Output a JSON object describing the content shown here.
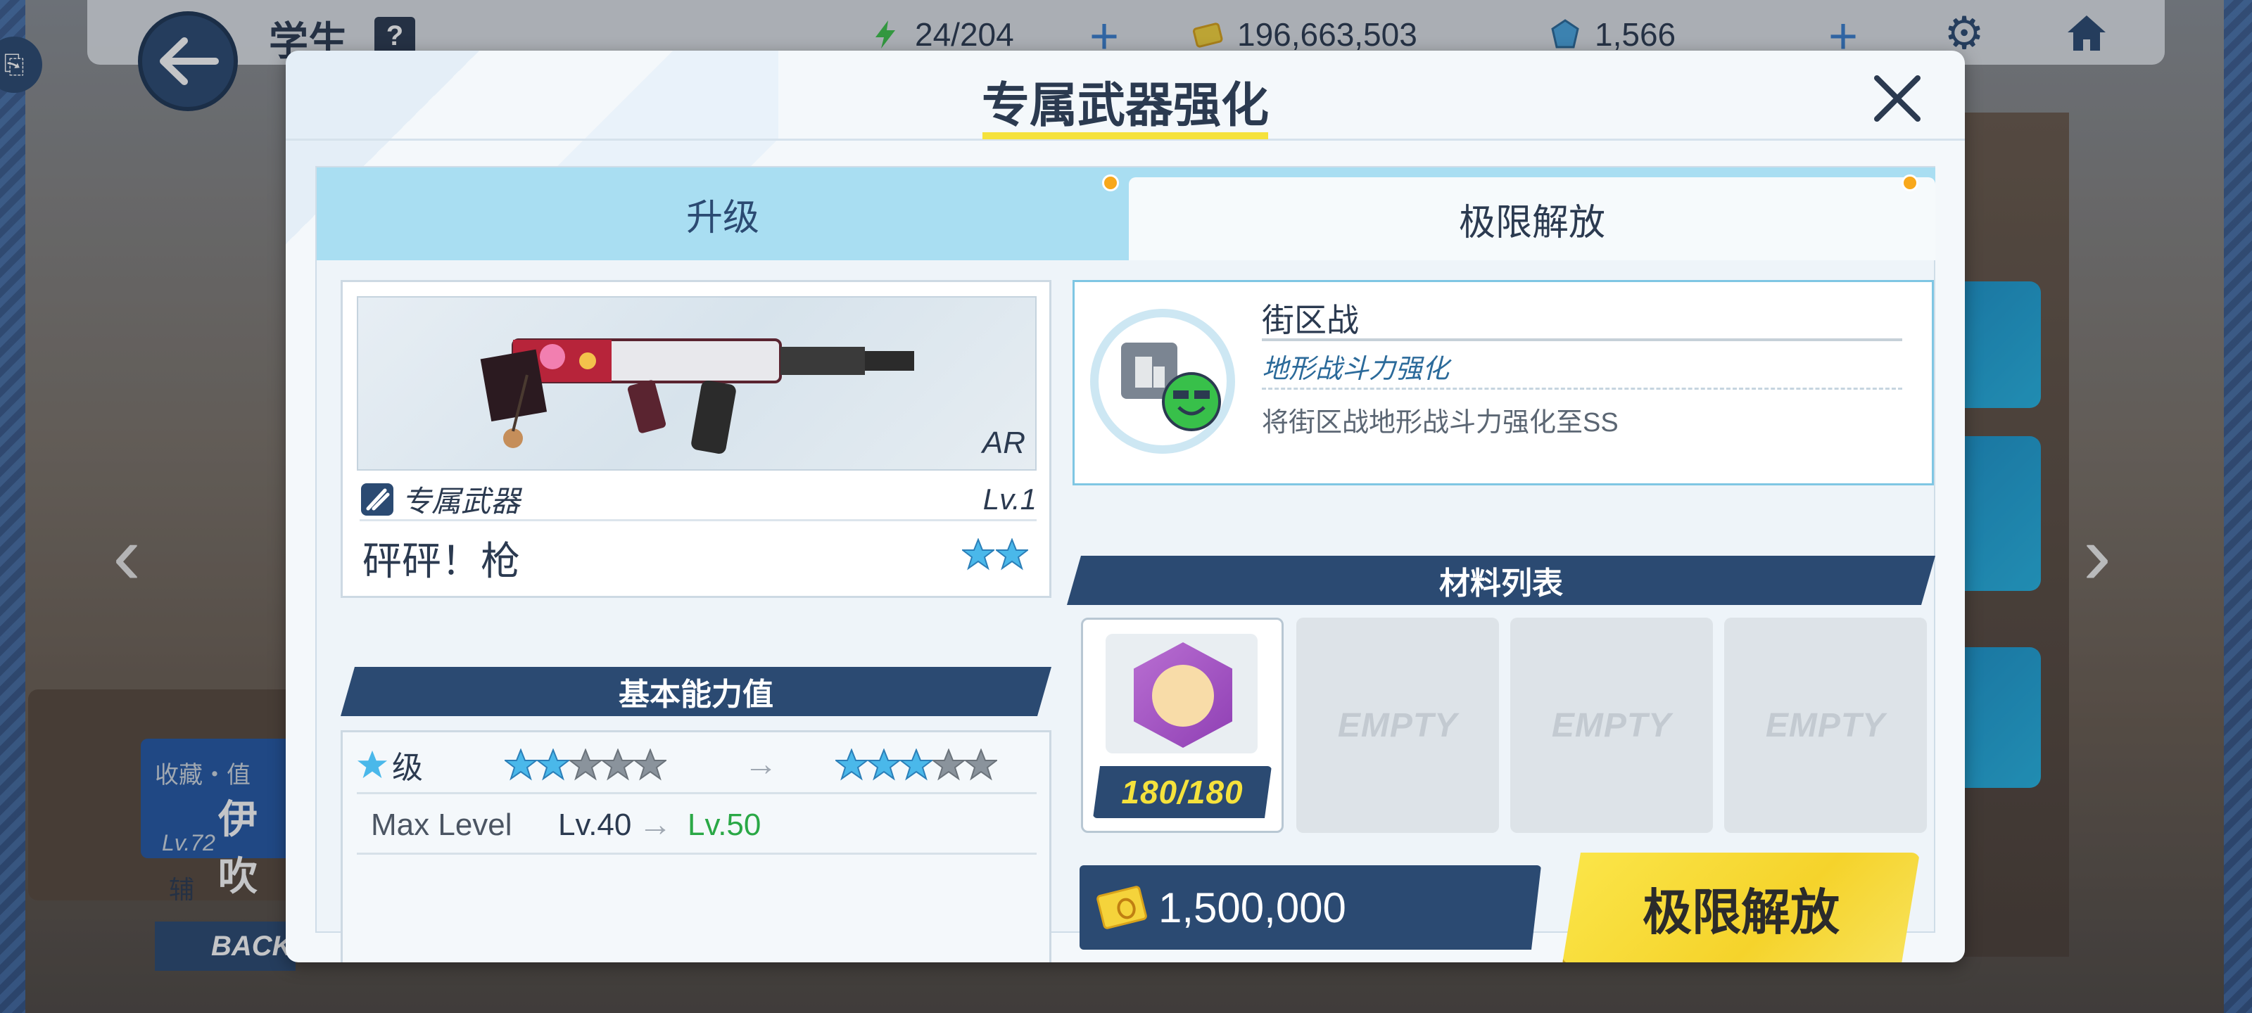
{
  "topbar": {
    "title": "学生",
    "help": "?",
    "ap": "24/204",
    "credits": "196,663,503",
    "gems": "1,566"
  },
  "background": {
    "back_label": "BACK",
    "name_partial": "伊吹",
    "level": "Lv.72",
    "favorite_label": "收藏・值",
    "support_label": "辅"
  },
  "modal": {
    "title": "专属武器强化",
    "tabs": [
      {
        "label": "升级"
      },
      {
        "label": "极限解放"
      }
    ],
    "weapon": {
      "type": "AR",
      "category": "专属武器",
      "level": "Lv.1",
      "name": "砰砰！枪",
      "stars": 2
    },
    "stats": {
      "header": "基本能力值",
      "grade_label": "级",
      "from_stars": 2,
      "to_stars": 3,
      "total_stars": 5,
      "max_level_label": "Max Level",
      "max_level_from": "Lv.40",
      "max_level_to": "Lv.50"
    },
    "terrain": {
      "title": "街区战",
      "subtitle": "地形战斗力强化",
      "description": "将街区战地形战斗力强化至SS"
    },
    "materials": {
      "header": "材料列表",
      "item_count": "180/180",
      "empty_label": "EMPTY"
    },
    "cost": "1,500,000",
    "action_label": "极限解放"
  },
  "colors": {
    "navy": "#2b4a72",
    "accent_yellow": "#f5e23c",
    "tab_blue": "#a9def2",
    "green": "#2aa846",
    "star_blue": "#4ab8ea"
  }
}
